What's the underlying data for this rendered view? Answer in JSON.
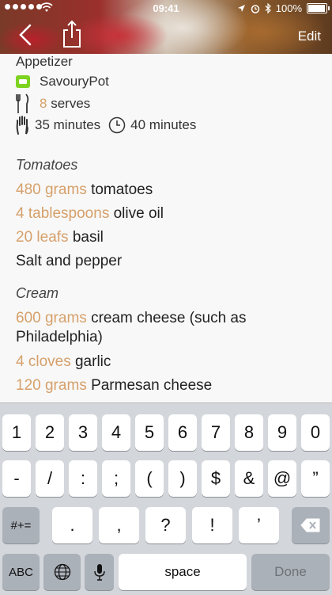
{
  "status": {
    "time": "09:41",
    "battery": "100%"
  },
  "nav": {
    "edit_label": "Edit"
  },
  "recipe": {
    "category": "Appetizer",
    "source": "SavouryPot",
    "serves_qty": "8",
    "serves_label": "serves",
    "prep_time": "35 minutes",
    "cook_time": "40 minutes",
    "sections": [
      {
        "title": "Tomatoes",
        "items": [
          {
            "qty": "480 grams",
            "name": "tomatoes"
          },
          {
            "qty": "4 tablespoons",
            "name": "olive oil"
          },
          {
            "qty": "20 leafs",
            "name": "basil"
          },
          {
            "qty": "",
            "name": "Salt and pepper"
          }
        ]
      },
      {
        "title": "Cream",
        "items": [
          {
            "qty": "600 grams",
            "name": "cream cheese (such as Philadelphia)"
          },
          {
            "qty": "4 cloves",
            "name": "garlic"
          },
          {
            "qty": "120 grams",
            "name": "Parmesan cheese"
          }
        ]
      }
    ]
  },
  "keyboard": {
    "row1": [
      "1",
      "2",
      "3",
      "4",
      "5",
      "6",
      "7",
      "8",
      "9",
      "0"
    ],
    "row2": [
      "-",
      "/",
      ":",
      ";",
      "(",
      ")",
      "$",
      "&",
      "@",
      "”"
    ],
    "row3_left": "#+=",
    "row3": [
      ".",
      ",",
      "?",
      "!",
      "’"
    ],
    "abc": "ABC",
    "space": "space",
    "done": "Done"
  },
  "colors": {
    "accent": "#d6a06a",
    "keyboard_bg": "#d3d6db",
    "fn_key": "#abb1b9"
  }
}
